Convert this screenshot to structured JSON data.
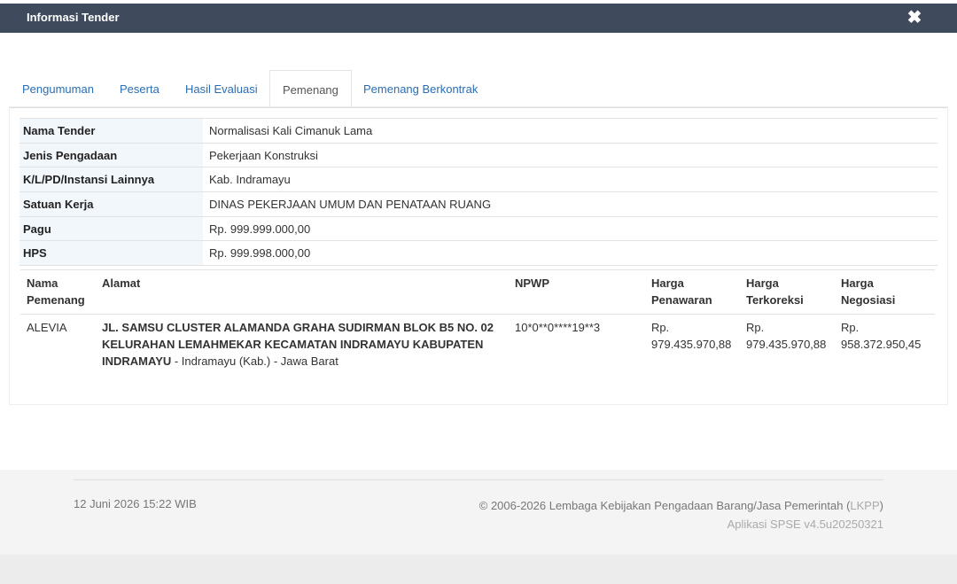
{
  "header": {
    "title": "Informasi Tender",
    "close_icon": "close-icon"
  },
  "tabs": [
    {
      "label": "Pengumuman"
    },
    {
      "label": "Peserta"
    },
    {
      "label": "Hasil Evaluasi"
    },
    {
      "label": "Pemenang",
      "active": true
    },
    {
      "label": "Pemenang Berkontrak"
    }
  ],
  "info": [
    {
      "label": "Nama Tender",
      "value": "Normalisasi Kali Cimanuk Lama"
    },
    {
      "label": "Jenis Pengadaan",
      "value": "Pekerjaan Konstruksi"
    },
    {
      "label": "K/L/PD/Instansi Lainnya",
      "value": "Kab. Indramayu"
    },
    {
      "label": "Satuan Kerja",
      "value": "DINAS PEKERJAAN UMUM DAN PENATAAN RUANG"
    },
    {
      "label": "Pagu",
      "value": "Rp. 999.999.000,00"
    },
    {
      "label": "HPS",
      "value": "Rp. 999.998.000,00"
    }
  ],
  "winners": {
    "headers": {
      "name": "Nama Pemenang",
      "address": "Alamat",
      "npwp": "NPWP",
      "offer": "Harga Penawaran",
      "corrected": "Harga Terkoreksi",
      "negotiated": "Harga Negosiasi"
    },
    "rows": [
      {
        "name": "ALEVIA",
        "address_bold": "JL. SAMSU CLUSTER ALAMANDA GRAHA SUDIRMAN BLOK B5 NO. 02 KELURAHAN LEMAHMEKAR KECAMATAN INDRAMAYU KABUPATEN INDRAMAYU",
        "address_rest": " - Indramayu (Kab.) - Jawa Barat",
        "npwp": "10*0**0****19**3",
        "offer": "Rp. 979.435.970,88",
        "corrected": "Rp. 979.435.970,88",
        "negotiated": "Rp. 958.372.950,45"
      }
    ]
  },
  "footer": {
    "date": "12 Juni 2026 15:22 WIB",
    "copyright_prefix": "© 2006-2026 Lembaga Kebijakan Pengadaan Barang/Jasa Pemerintah (",
    "copyright_link": "LKPP",
    "copyright_suffix": ")",
    "version": "Aplikasi SPSE v4.5u20250321"
  }
}
